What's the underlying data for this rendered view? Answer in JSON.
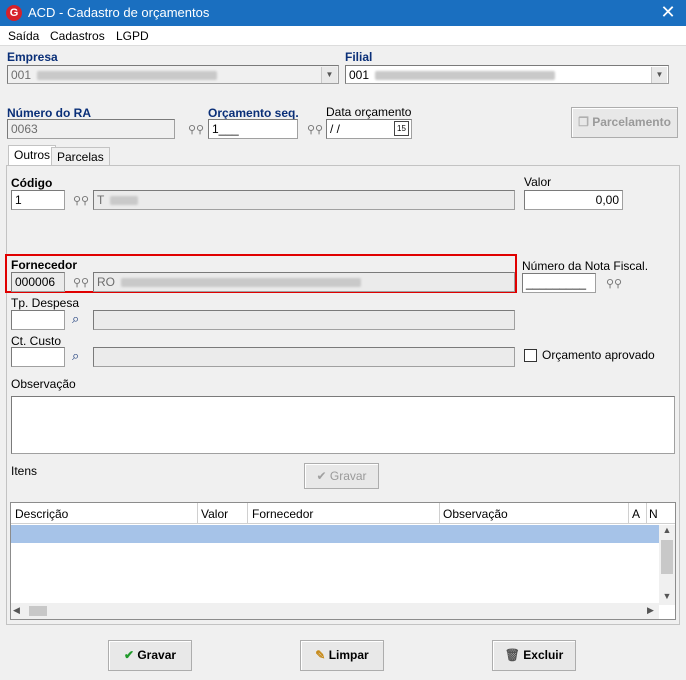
{
  "window": {
    "title": "ACD - Cadastro de orçamentos",
    "close_glyph": "✕",
    "app_icon": "G"
  },
  "menu": [
    "Saída",
    "Cadastros",
    "LGPD"
  ],
  "empresa": {
    "label": "Empresa",
    "value": "001"
  },
  "filial": {
    "label": "Filial",
    "value": "001"
  },
  "numero_ra": {
    "label": "Número do RA",
    "value": "0063"
  },
  "orcamento_seq": {
    "label": "Orçamento seq.",
    "value": "1___"
  },
  "data_orcamento": {
    "label": "Data orçamento",
    "value": " / /",
    "calendar_glyph": "15"
  },
  "parcelamento_button": "Parcelamento",
  "tabs": [
    "Outros",
    "Parcelas"
  ],
  "codigo": {
    "label": "Código",
    "value": "1",
    "desc": "T"
  },
  "valor": {
    "label": "Valor",
    "value": "0,00"
  },
  "fornecedor": {
    "label": "Fornecedor",
    "value": "000006",
    "desc": "RO"
  },
  "nota_fiscal": {
    "label": "Número da Nota Fiscal.",
    "value": "_________"
  },
  "tp_despesa": {
    "label": "Tp. Despesa",
    "value": ""
  },
  "ct_custo": {
    "label": "Ct. Custo",
    "value": ""
  },
  "orcamento_aprovado": {
    "label": "Orçamento aprovado",
    "checked": false
  },
  "observacao": {
    "label": "Observação",
    "value": ""
  },
  "itens": {
    "label": "Itens",
    "gravar_button": "Gravar",
    "columns": [
      "Descrição",
      "Valor",
      "Fornecedor",
      "Observação",
      "A",
      "N"
    ]
  },
  "footer": {
    "gravar": "Gravar",
    "limpar": "Limpar",
    "excluir": "Excluir"
  },
  "colors": {
    "titlebar": "#1a6fc0",
    "highlight_border": "#e00000",
    "selected_row": "#a6c3e8"
  }
}
